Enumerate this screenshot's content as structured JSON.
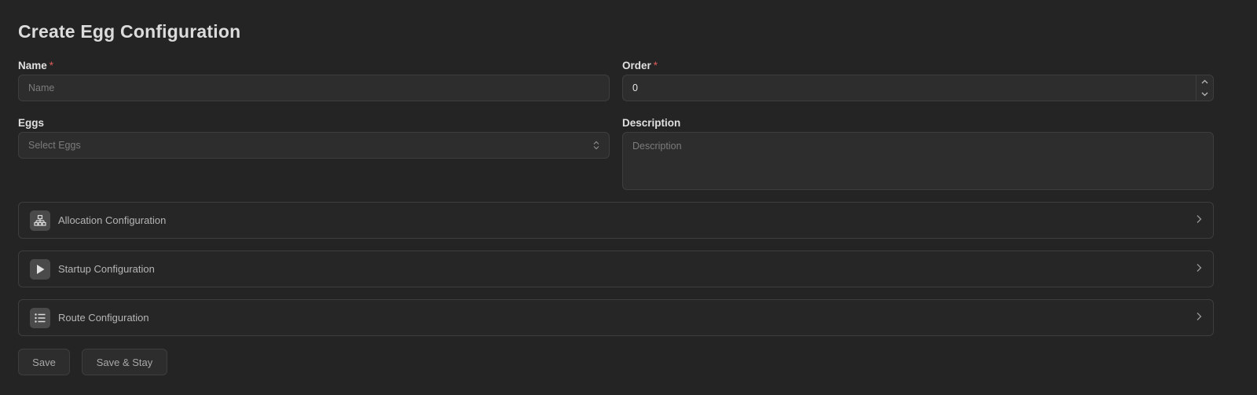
{
  "page": {
    "title": "Create Egg Configuration"
  },
  "form": {
    "name": {
      "label": "Name",
      "required_mark": "*",
      "placeholder": "Name",
      "value": ""
    },
    "order": {
      "label": "Order",
      "required_mark": "*",
      "value": "0"
    },
    "eggs": {
      "label": "Eggs",
      "placeholder": "Select Eggs"
    },
    "description": {
      "label": "Description",
      "placeholder": "Description",
      "value": ""
    }
  },
  "sections": [
    {
      "label": "Allocation Configuration",
      "icon": "network-icon"
    },
    {
      "label": "Startup Configuration",
      "icon": "play-icon"
    },
    {
      "label": "Route Configuration",
      "icon": "list-icon"
    }
  ],
  "actions": {
    "save_label": "Save",
    "save_stay_label": "Save & Stay"
  },
  "colors": {
    "background": "#242424",
    "field": "#2d2d2d",
    "border": "#3e3e3e",
    "required": "#e05a5a"
  }
}
